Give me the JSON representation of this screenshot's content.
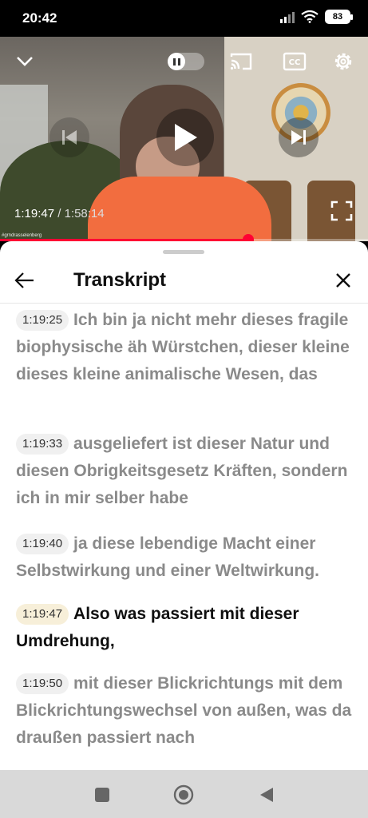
{
  "status_bar": {
    "time": "20:42",
    "battery": "83"
  },
  "video": {
    "current_time": "1:19:47",
    "separator": " / ",
    "duration": "1:58:14",
    "progress_fraction": 0.675,
    "watermark": "#grndrasselenberg"
  },
  "transcript": {
    "title": "Transkript",
    "segments": [
      {
        "timestamp": "1:19:25",
        "text": "Ich bin ja nicht mehr dieses fragile biophysische äh Würstchen, dieser kleine dieses kleine animalische Wesen, das",
        "active": false
      },
      {
        "timestamp": "1:19:33",
        "text": "ausgeliefert ist dieser Natur und diesen Obrigkeitsgesetz Kräften, sondern ich in mir selber habe",
        "active": false
      },
      {
        "timestamp": "1:19:40",
        "text": "ja diese lebendige Macht einer Selbstwirkung und einer Weltwirkung.",
        "active": false
      },
      {
        "timestamp": "1:19:47",
        "text": "Also was passiert mit dieser Umdrehung,",
        "active": true
      },
      {
        "timestamp": "1:19:50",
        "text": "mit dieser Blickrichtungs mit dem Blickrichtungswechsel von außen, was da draußen passiert nach",
        "active": false
      }
    ]
  },
  "colors": {
    "accent": "#ff0033",
    "active_timestamp_bg": "#f7efd9"
  }
}
